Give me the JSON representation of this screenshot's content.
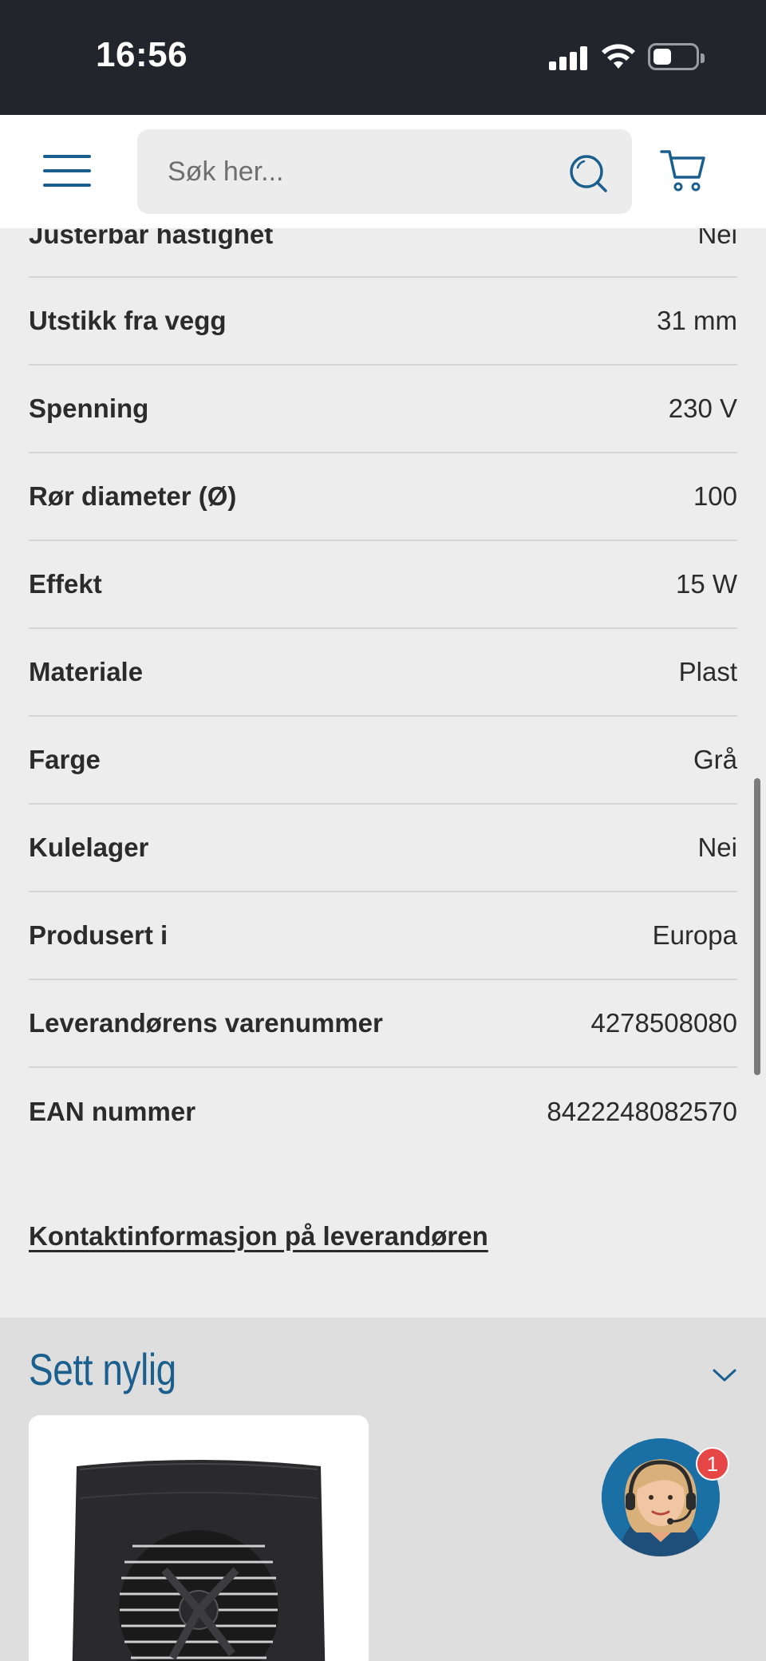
{
  "status_bar": {
    "time": "16:56"
  },
  "header": {
    "search_placeholder": "Søk her...",
    "menu_icon": "hamburger-menu-icon",
    "search_icon": "search-icon",
    "cart_icon": "cart-icon"
  },
  "specs": [
    {
      "label": "Justerbar hastighet",
      "value": "Nei"
    },
    {
      "label": "Utstikk fra vegg",
      "value": "31 mm"
    },
    {
      "label": "Spenning",
      "value": "230 V"
    },
    {
      "label": "Rør diameter (Ø)",
      "value": "100"
    },
    {
      "label": "Effekt",
      "value": "15 W"
    },
    {
      "label": "Materiale",
      "value": "Plast"
    },
    {
      "label": "Farge",
      "value": "Grå"
    },
    {
      "label": "Kulelager",
      "value": "Nei"
    },
    {
      "label": "Produsert i",
      "value": "Europa"
    },
    {
      "label": "Leverandørens varenummer",
      "value": "4278508080"
    },
    {
      "label": "EAN nummer",
      "value": "8422248082570"
    }
  ],
  "contact_link": "Kontaktinformasjon på leverandøren",
  "recently_viewed": {
    "title": "Sett nylig"
  },
  "chat": {
    "badge_count": "1"
  },
  "colors": {
    "accent": "#1a5f8e",
    "header_bg": "#22252b",
    "badge": "#e64646"
  }
}
